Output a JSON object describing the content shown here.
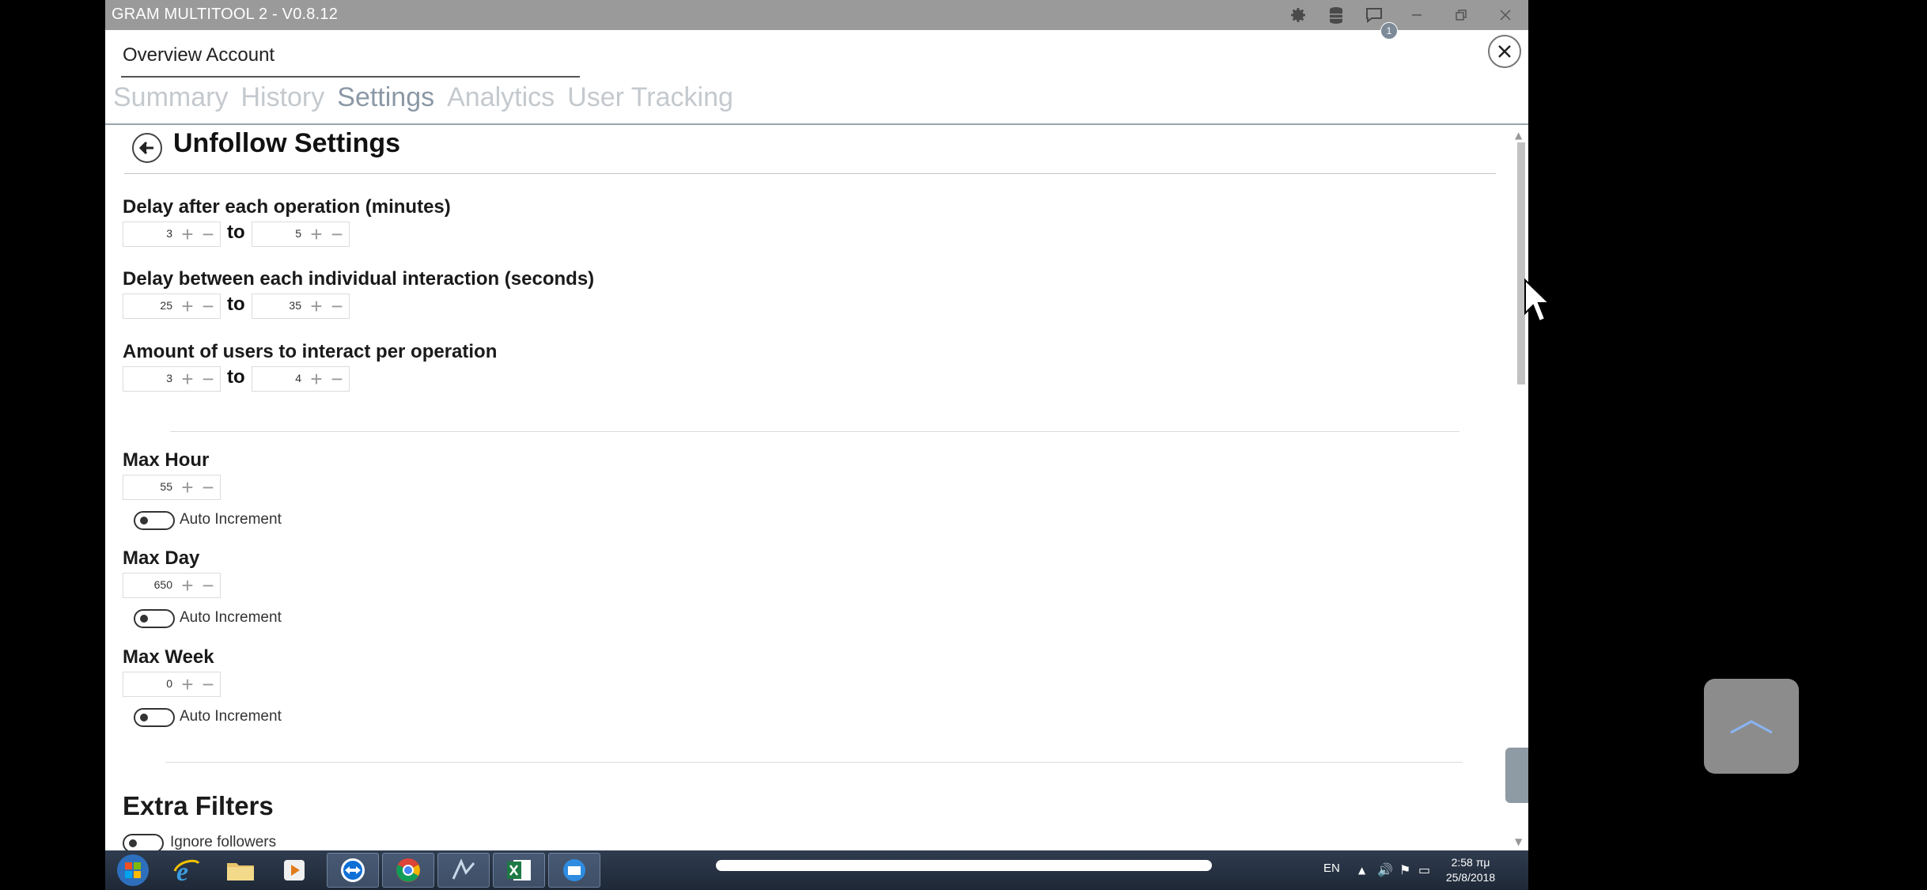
{
  "window": {
    "title": "GRAM MULTITOOL 2 - V0.8.12",
    "notification_count": "1"
  },
  "header": {
    "account_title": "Overview Account"
  },
  "tabs": [
    {
      "label": "Summary",
      "active": false
    },
    {
      "label": "History",
      "active": false
    },
    {
      "label": "Settings",
      "active": true
    },
    {
      "label": "Analytics",
      "active": false
    },
    {
      "label": "User Tracking",
      "active": false
    }
  ],
  "page": {
    "title": "Unfollow Settings",
    "to_label": "to",
    "delay_operation": {
      "label": "Delay after each operation (minutes)",
      "from": "3",
      "to": "5"
    },
    "delay_interaction": {
      "label": "Delay between each individual interaction (seconds)",
      "from": "25",
      "to": "35"
    },
    "users_per_operation": {
      "label": "Amount of users to interact per operation",
      "from": "3",
      "to": "4"
    },
    "max_hour": {
      "label": "Max Hour",
      "value": "55",
      "auto_increment": "Auto Increment"
    },
    "max_day": {
      "label": "Max Day",
      "value": "650",
      "auto_increment": "Auto Increment"
    },
    "max_week": {
      "label": "Max Week",
      "value": "0",
      "auto_increment": "Auto Increment"
    },
    "extra_filters": {
      "title": "Extra Filters",
      "ignore_followers": "Ignore followers"
    }
  },
  "taskbar": {
    "language": "EN",
    "time": "2:58 πμ",
    "date": "25/8/2018"
  },
  "colors": {
    "titlebar": "#9a9a9a",
    "tab_inactive": "#c4c9ce",
    "tab_active": "#8b98a5",
    "taskbar": "#1e2836",
    "float_button": "#8c8c8c"
  }
}
